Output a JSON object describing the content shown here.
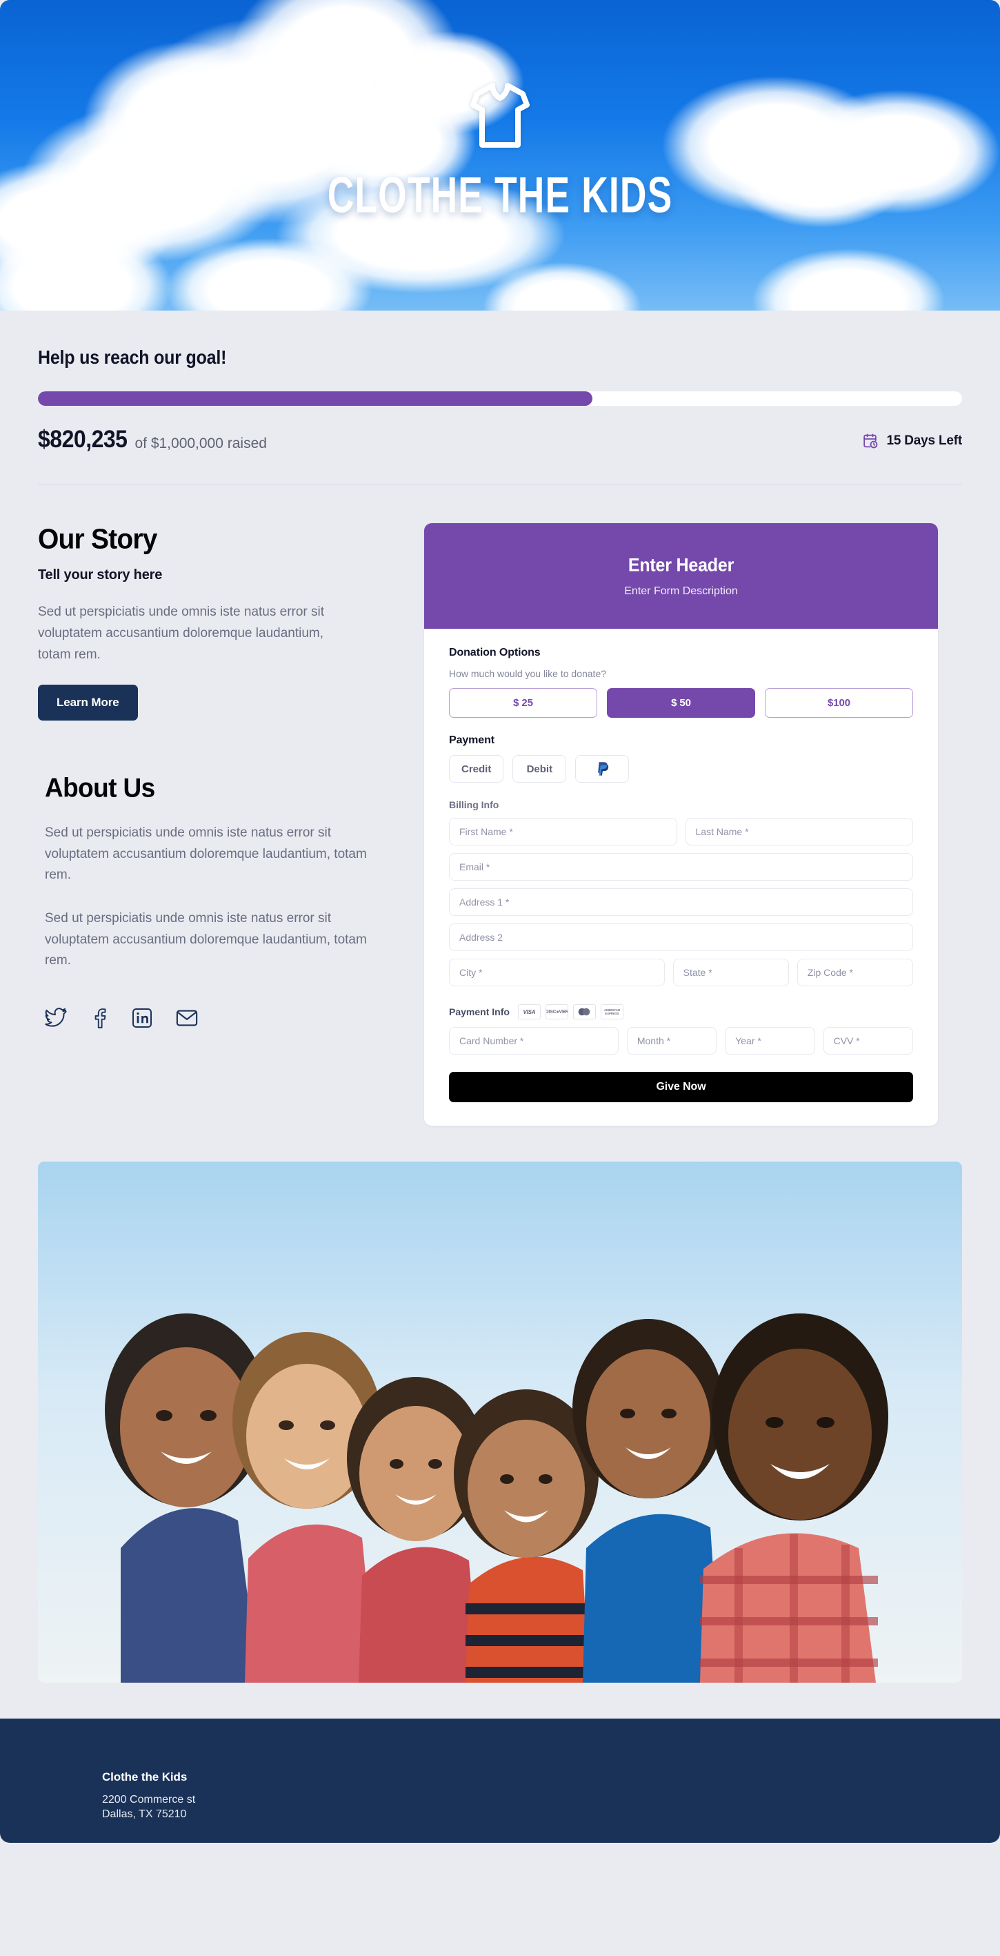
{
  "hero": {
    "logo_icon": "tshirt-icon",
    "title": "CLOTHE THE KIDS"
  },
  "goal": {
    "title": "Help us reach our goal!",
    "progress_percent": 60,
    "raised_amount": "$820,235",
    "goal_text": "of $1,000,000 raised",
    "days_icon": "calendar-clock-icon",
    "days_left": "15 Days Left",
    "accent_color": "#7549ac"
  },
  "story": {
    "title": "Our Story",
    "subtitle": "Tell your story here",
    "body": "Sed ut perspiciatis unde omnis iste natus error sit voluptatem accusantium doloremque laudantium, totam rem.",
    "learn_more_label": "Learn More",
    "button_color": "#1b3258"
  },
  "about": {
    "title": "About Us",
    "paragraph_1": "Sed ut perspiciatis unde omnis iste natus error sit voluptatem accusantium doloremque laudantium, totam rem.",
    "paragraph_2": "Sed ut perspiciatis unde omnis iste natus error sit voluptatem accusantium doloremque laudantium, totam rem.",
    "socials": [
      {
        "name": "twitter",
        "icon": "twitter-icon"
      },
      {
        "name": "facebook",
        "icon": "facebook-icon"
      },
      {
        "name": "linkedin",
        "icon": "linkedin-icon"
      },
      {
        "name": "email",
        "icon": "email-icon"
      }
    ]
  },
  "form": {
    "header_title": "Enter Header",
    "header_description": "Enter Form Description",
    "header_color": "#7549ac",
    "donation": {
      "section_title": "Donation Options",
      "help_text": "How much would you like to donate?",
      "options": [
        {
          "label": "$ 25",
          "selected": false
        },
        {
          "label": "$ 50",
          "selected": true
        },
        {
          "label": "$100",
          "selected": false
        }
      ]
    },
    "payment": {
      "section_title": "Payment",
      "methods": [
        {
          "label": "Credit",
          "icon": ""
        },
        {
          "label": "Debit",
          "icon": ""
        },
        {
          "label": "",
          "icon": "paypal-icon"
        }
      ]
    },
    "billing": {
      "label": "Billing Info",
      "fields": [
        {
          "placeholder": "First Name *",
          "name": "first-name-field"
        },
        {
          "placeholder": "Last Name *",
          "name": "last-name-field"
        },
        {
          "placeholder": "Email *",
          "name": "email-field"
        },
        {
          "placeholder": "Address 1 *",
          "name": "address-1-field"
        },
        {
          "placeholder": "Address 2",
          "name": "address-2-field"
        },
        {
          "placeholder": "City *",
          "name": "city-field"
        },
        {
          "placeholder": "State *",
          "name": "state-field"
        },
        {
          "placeholder": "Zip Code *",
          "name": "zip-code-field"
        }
      ]
    },
    "payment_info": {
      "label": "Payment Info",
      "card_brands": [
        "VISA",
        "DISCOVER",
        "mastercard",
        "AMERICAN EXPRESS"
      ],
      "fields": [
        {
          "placeholder": "Card Number *",
          "name": "card-number-field"
        },
        {
          "placeholder": "Month *",
          "name": "expiry-month-field"
        },
        {
          "placeholder": "Year *",
          "name": "expiry-year-field"
        },
        {
          "placeholder": "CVV *",
          "name": "cvv-field"
        }
      ]
    },
    "submit_label": "Give Now"
  },
  "photo": {
    "alt": "group-of-smiling-children-photo"
  },
  "footer": {
    "org_name": "Clothe the Kids",
    "address": "2200 Commerce st\nDallas, TX 75210",
    "background_color": "#1b3258"
  }
}
